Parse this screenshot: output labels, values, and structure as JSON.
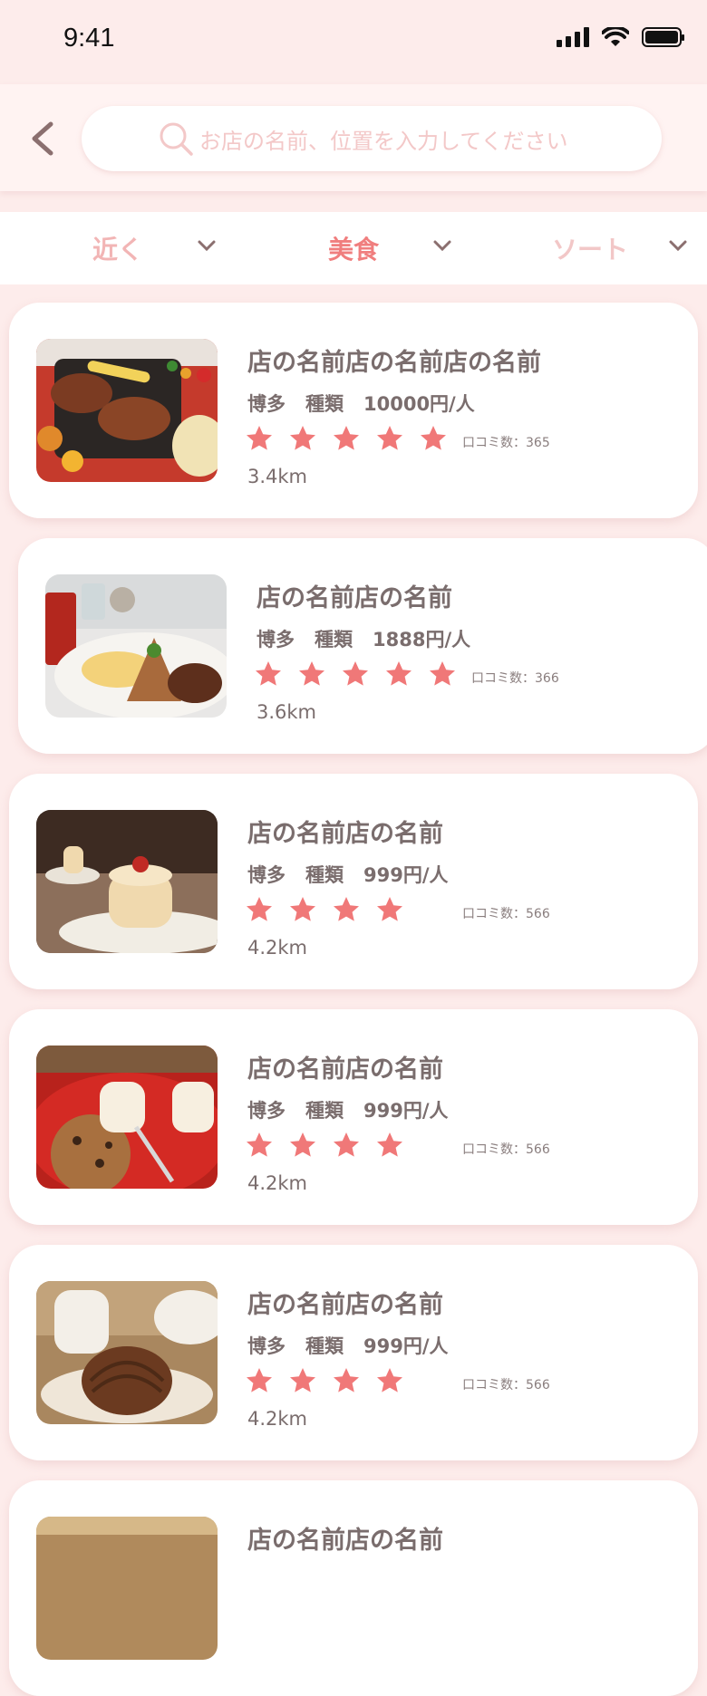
{
  "status_bar": {
    "time": "9:41"
  },
  "search": {
    "placeholder": "お店の名前、位置を入力してください"
  },
  "filters": [
    {
      "label": "近く",
      "color": "#f2b5b5"
    },
    {
      "label": "美食",
      "color": "#f07e7e"
    },
    {
      "label": "ソート",
      "color": "#f2c7c7"
    }
  ],
  "colors": {
    "background": "#fdeceb",
    "accent": "#f07e7e",
    "star": "#f07878",
    "text": "#7a6d6d"
  },
  "restaurants": [
    {
      "name": "店の名前店の名前店の名前",
      "area": "博多",
      "category": "種類",
      "price": "10000円/人",
      "rating": 5,
      "reviews": "口コミ数：365",
      "distance": "3.4km",
      "image": "bbq-grill"
    },
    {
      "name": "店の名前店の名前",
      "area": "博多",
      "category": "種類",
      "price": "1888円/人",
      "rating": 5,
      "reviews": "口コミ数：366",
      "distance": "3.6km",
      "image": "breakfast-plate"
    },
    {
      "name": "店の名前店の名前",
      "area": "博多",
      "category": "種類",
      "price": "999円/人",
      "rating": 4,
      "reviews": "口コミ数：566",
      "distance": "4.2km",
      "image": "mousse-cake"
    },
    {
      "name": "店の名前店の名前",
      "area": "博多",
      "category": "種類",
      "price": "999円/人",
      "rating": 4,
      "reviews": "口コミ数：566",
      "distance": "4.2km",
      "image": "cookie-dessert"
    },
    {
      "name": "店の名前店の名前",
      "area": "博多",
      "category": "種類",
      "price": "999円/人",
      "rating": 4,
      "reviews": "口コミ数：566",
      "distance": "4.2km",
      "image": "mont-blanc-tea"
    },
    {
      "name": "店の名前店の名前",
      "image": "cake-partial"
    }
  ]
}
